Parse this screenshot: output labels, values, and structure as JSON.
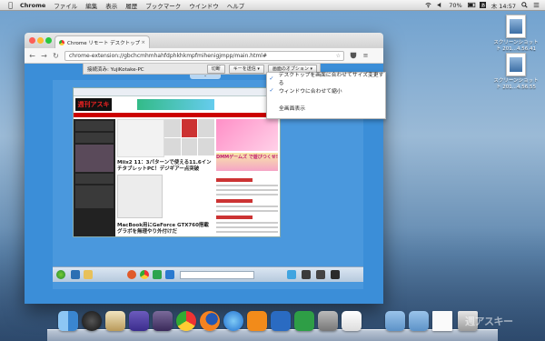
{
  "menubar": {
    "app": "Chrome",
    "items": [
      "ファイル",
      "編集",
      "表示",
      "履歴",
      "ブックマーク",
      "ウインドウ",
      "ヘルプ"
    ],
    "battery": "70%",
    "clock": "木 14:57"
  },
  "desktop_icons": [
    {
      "label_line1": "スクリーンショット",
      "label_line2": "ト 201...4.56.41"
    },
    {
      "label_line1": "スクリーンショット",
      "label_line2": "ト 201...4.56.55"
    }
  ],
  "chrome": {
    "tab_title": "Chrome リモート デスクトップ",
    "url": "chrome-extension://gbchcmhmhahfdphkhkmpfmihenigjmpp/main.html#"
  },
  "remote_bar": {
    "status": "接続済み: YujiKotake-PC",
    "disconnect_label": "切断",
    "send_keys_label": "キーを送信",
    "screen_options_label": "画面のオプション"
  },
  "screen_options_menu": [
    {
      "checked": true,
      "label": "デスクトップを画面に合わせてサイズ変更する"
    },
    {
      "checked": true,
      "label": "ウィンドウに合わせて縮小"
    },
    {
      "checked": false,
      "label": "全画面表示"
    }
  ],
  "remote_page": {
    "logo": "週刊アスキー",
    "dmm_banner": "DMMゲームズ で遊びつくせ!",
    "headline1": "Miix2 11：3パターンで使える11.6インチタブレットPC！デジギアー点突破",
    "headline2": "MacBook用にGeForce GTX760搭載グラボを無理やり外付けだ"
  },
  "dock": {
    "items": [
      "finder-icon",
      "dashboard-icon",
      "preview-icon",
      "floppy-icon",
      "script-icon",
      "chrome-icon",
      "firefox-icon",
      "itunes-icon",
      "ibooks-icon",
      "word-icon",
      "excel-icon",
      "system-preferences-icon",
      "textedit-icon",
      "applications-folder-icon",
      "downloads-folder-icon",
      "document-icon",
      "trash-icon"
    ]
  },
  "watermark": "週アスキー",
  "colors": {
    "accent": "#3b8ed8",
    "check": "#1a63c7"
  }
}
